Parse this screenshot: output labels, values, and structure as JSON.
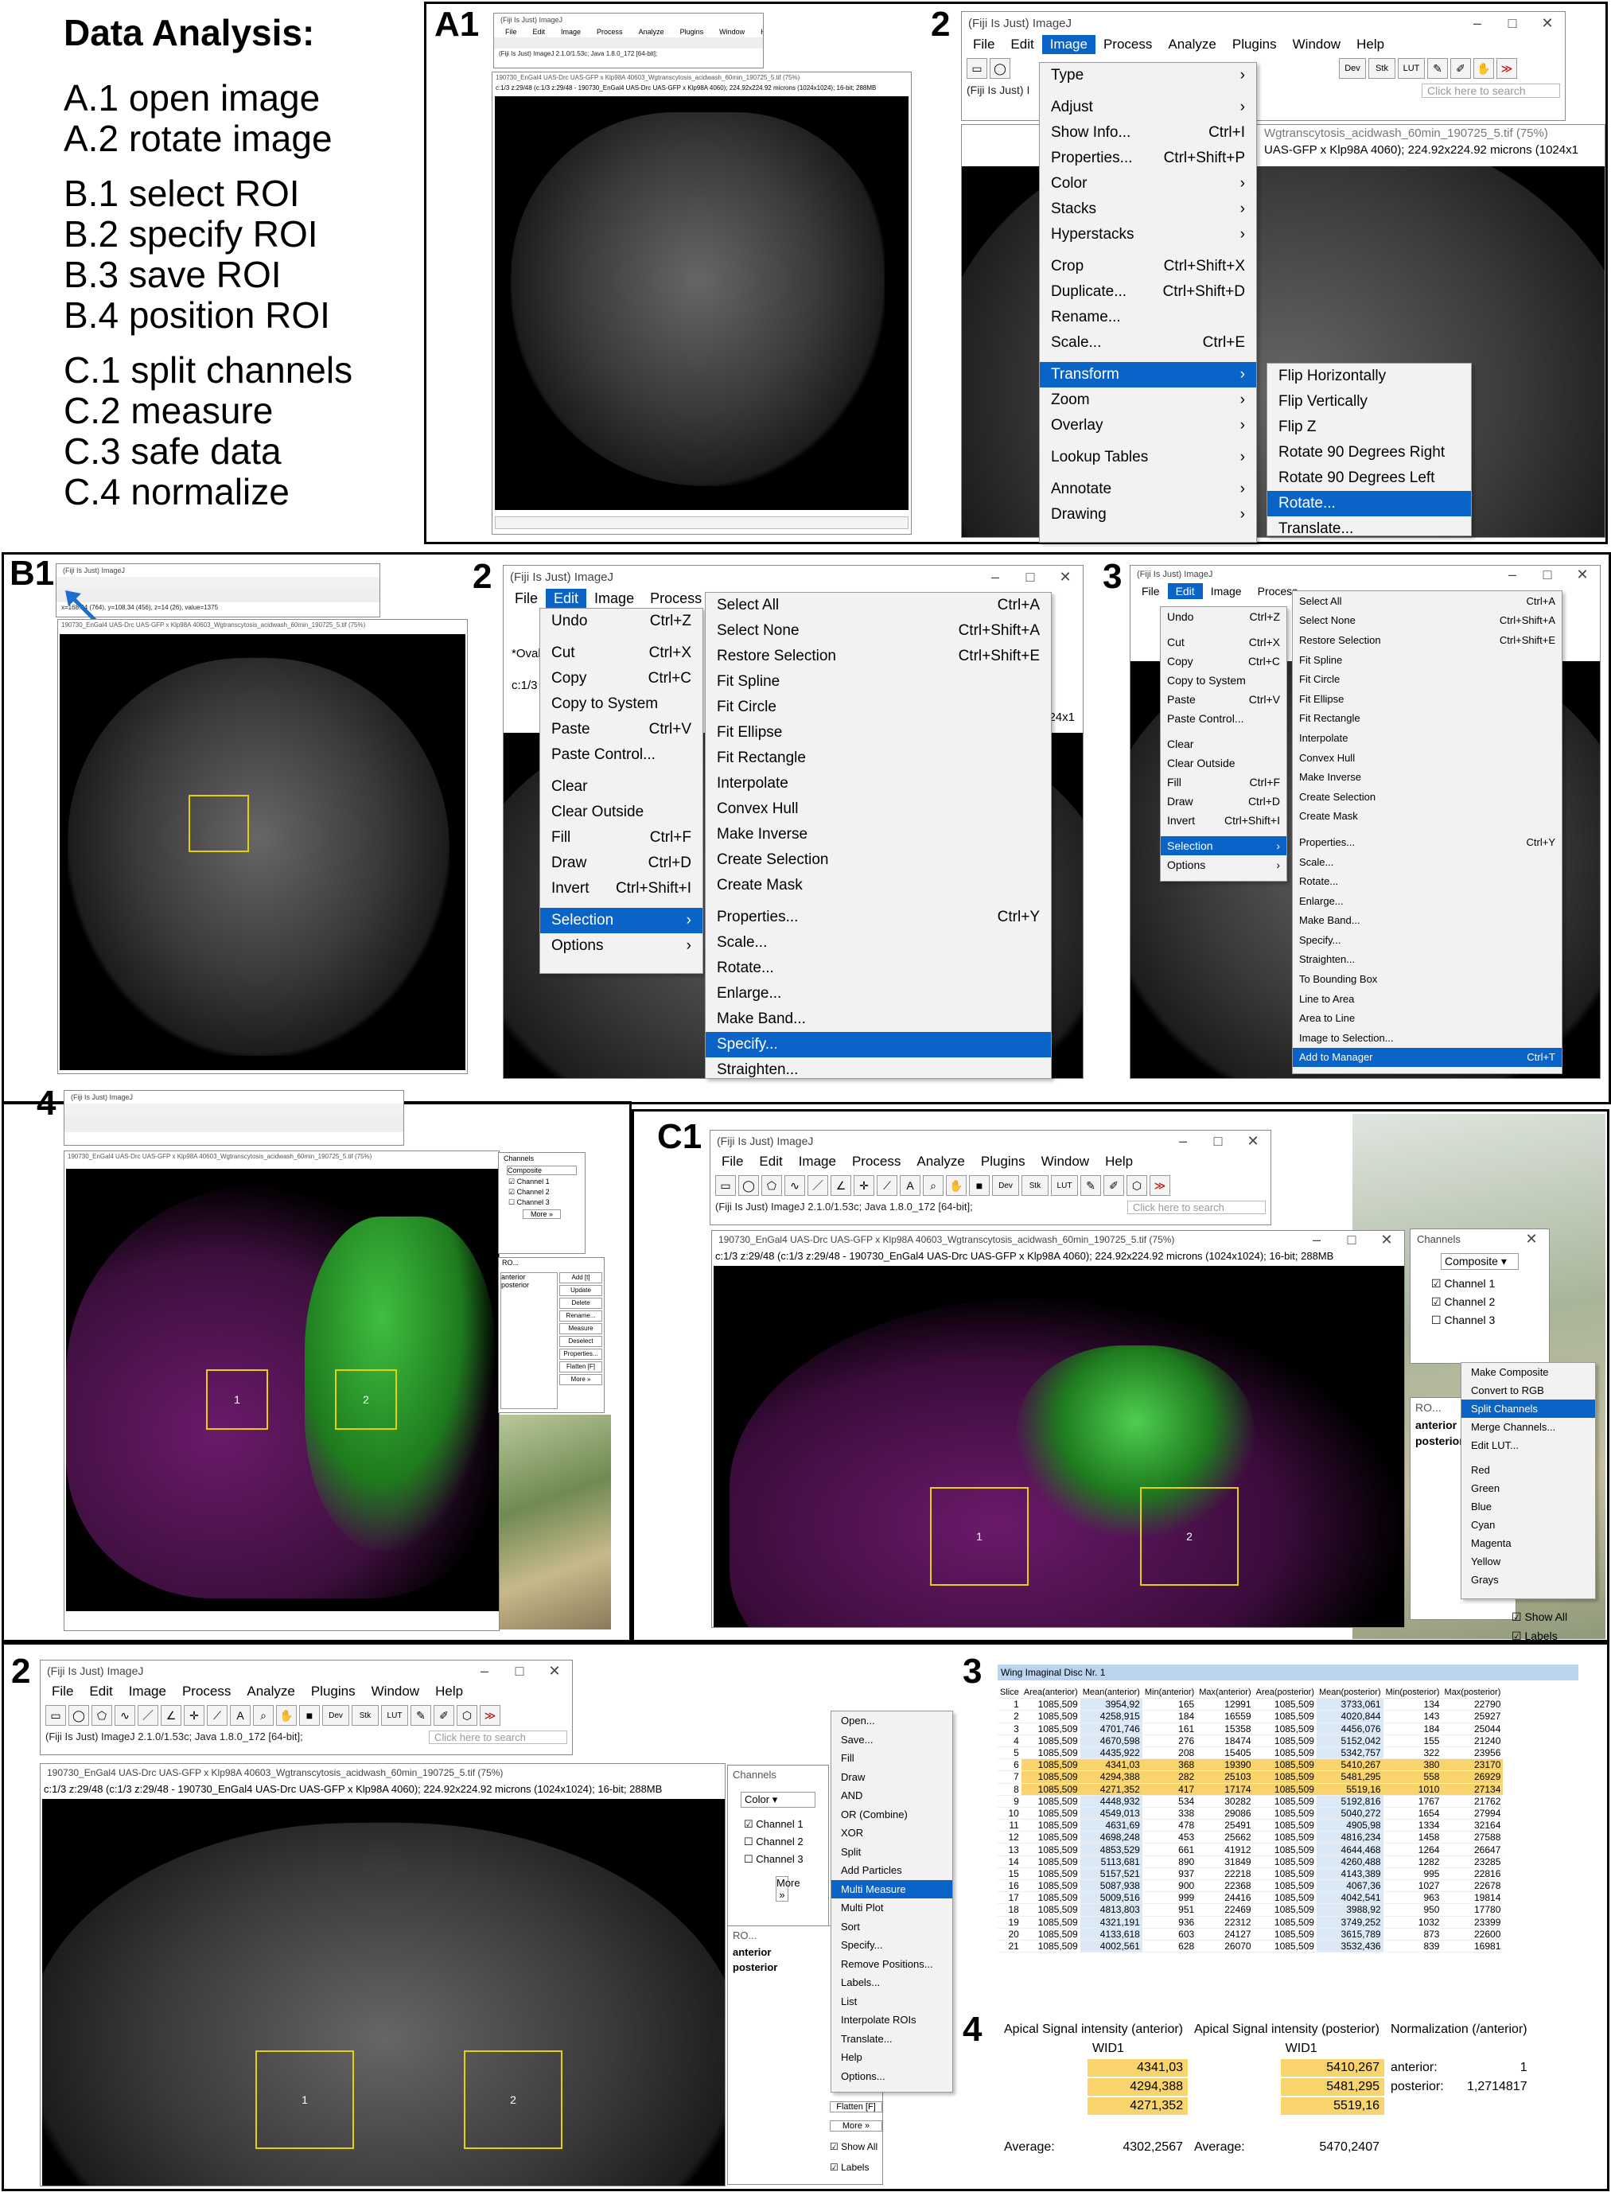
{
  "analysis": {
    "title": "Data Analysis:",
    "steps": [
      "A.1 open image",
      "A.2 rotate image",
      "B.1 select ROI",
      "B.2 specify ROI",
      "B.3 save ROI",
      "B.4 position ROI",
      "C.1 split channels",
      "C.2 measure",
      "C.3 safe data",
      "C.4 normalize"
    ]
  },
  "labels": {
    "a1": "A1",
    "a2": "2",
    "b1": "B1",
    "b2": "2",
    "b3": "3",
    "b4": "4",
    "c1": "C1",
    "c2": "2",
    "c3": "3",
    "c4": "4"
  },
  "imagej": {
    "title": "(Fiji Is Just) ImageJ",
    "menus": [
      "File",
      "Edit",
      "Image",
      "Process",
      "Analyze",
      "Plugins",
      "Window",
      "Help"
    ],
    "status": "(Fiji Is Just) ImageJ 2.1.0/1.53c; Java 1.8.0_172 [64-bit];",
    "status_short": "(Fiji Is Just) I",
    "search_placeholder": "Click here to search",
    "tools": {
      "dev": "Dev",
      "stk": "Stk",
      "lut": "LUT"
    },
    "b1_status": "x=168.34 (764), y=108.34 (456), z=14 (26), value=1375"
  },
  "image_window": {
    "title": "190730_EnGal4 UAS-Drc UAS-GFP  x Klp98A 40603_Wgtranscytosis_acidwash_60min_190725_5.tif (75%)",
    "title_short": "190730_E",
    "title_tail": "Wgtranscytosis_acidwash_60min_190725_5.tif (75%)",
    "info": "c:1/3 z:29/48 (c:1/3 z:29/48 - 190730_EnGal4 UAS-Drc UAS-GFP  x Klp98A 4060); 224.92x224.92 microns (1024x1024); 16-bit; 288MB",
    "info_short": "c:1/3",
    "info_tail": "UAS-GFP  x Klp98A 4060); 224.92x224.92 microns (1024x1",
    "info_b2": "(1024x1",
    "oval_hint": "*Oval*"
  },
  "image_menu": [
    {
      "label": "Type",
      "arrow": "›"
    },
    {
      "label": "Adjust",
      "arrow": "›"
    },
    {
      "label": "Show Info...",
      "sc": "Ctrl+I"
    },
    {
      "label": "Properties...",
      "sc": "Ctrl+Shift+P"
    },
    {
      "label": "Color",
      "arrow": "›"
    },
    {
      "label": "Stacks",
      "arrow": "›"
    },
    {
      "label": "Hyperstacks",
      "arrow": "›"
    },
    {
      "label": "Crop",
      "sc": "Ctrl+Shift+X"
    },
    {
      "label": "Duplicate...",
      "sc": "Ctrl+Shift+D"
    },
    {
      "label": "Rename..."
    },
    {
      "label": "Scale...",
      "sc": "Ctrl+E"
    },
    {
      "label": "Transform",
      "arrow": "›"
    },
    {
      "label": "Zoom",
      "arrow": "›"
    },
    {
      "label": "Overlay",
      "arrow": "›"
    },
    {
      "label": "Lookup Tables",
      "arrow": "›"
    },
    {
      "label": "Annotate",
      "arrow": "›"
    },
    {
      "label": "Drawing",
      "arrow": "›"
    }
  ],
  "transform_menu": [
    "Flip Horizontally",
    "Flip Vertically",
    "Flip Z",
    "Rotate 90 Degrees Right",
    "Rotate 90 Degrees Left",
    "Rotate...",
    "Translate..."
  ],
  "edit_menu": [
    {
      "label": "Undo",
      "sc": "Ctrl+Z"
    },
    {
      "label": "Cut",
      "sc": "Ctrl+X"
    },
    {
      "label": "Copy",
      "sc": "Ctrl+C"
    },
    {
      "label": "Copy to System"
    },
    {
      "label": "Paste",
      "sc": "Ctrl+V"
    },
    {
      "label": "Paste Control..."
    },
    {
      "label": "Clear"
    },
    {
      "label": "Clear Outside"
    },
    {
      "label": "Fill",
      "sc": "Ctrl+F"
    },
    {
      "label": "Draw",
      "sc": "Ctrl+D"
    },
    {
      "label": "Invert",
      "sc": "Ctrl+Shift+I"
    },
    {
      "label": "Selection",
      "arrow": "›"
    },
    {
      "label": "Options",
      "arrow": "›"
    }
  ],
  "selection_menu": [
    {
      "label": "Select All",
      "sc": "Ctrl+A"
    },
    {
      "label": "Select None",
      "sc": "Ctrl+Shift+A"
    },
    {
      "label": "Restore Selection",
      "sc": "Ctrl+Shift+E"
    },
    {
      "label": "Fit Spline"
    },
    {
      "label": "Fit Circle"
    },
    {
      "label": "Fit Ellipse"
    },
    {
      "label": "Fit Rectangle"
    },
    {
      "label": "Interpolate"
    },
    {
      "label": "Convex Hull"
    },
    {
      "label": "Make Inverse"
    },
    {
      "label": "Create Selection"
    },
    {
      "label": "Create Mask"
    },
    {
      "label": "Properties...",
      "sc": "Ctrl+Y"
    },
    {
      "label": "Scale..."
    },
    {
      "label": "Rotate..."
    },
    {
      "label": "Enlarge..."
    },
    {
      "label": "Make Band..."
    },
    {
      "label": "Specify..."
    },
    {
      "label": "Straighten..."
    },
    {
      "label": "To Bounding Box"
    },
    {
      "label": "Line to Area"
    },
    {
      "label": "Area to Line"
    },
    {
      "label": "Image to Selection..."
    },
    {
      "label": "Add to Manager",
      "sc": "Ctrl+T"
    }
  ],
  "channels": {
    "title": "Channels",
    "mode": "Composite",
    "mode_color": "Color",
    "items": [
      "Channel 1",
      "Channel 2",
      "Channel 3"
    ],
    "more": "More »"
  },
  "channels_more_menu": [
    "Make Composite",
    "Convert to RGB",
    "Split Channels",
    "Merge Channels...",
    "Edit LUT...",
    "Red",
    "Green",
    "Blue",
    "Cyan",
    "Magenta",
    "Yellow",
    "Grays"
  ],
  "roi_manager": {
    "title": "RO...",
    "items": [
      "anterior",
      "posterior"
    ],
    "buttons": [
      "Add [t]",
      "Update",
      "Delete",
      "Rename...",
      "Measure",
      "Deselect",
      "Properties...",
      "Flatten [F]",
      "More »"
    ],
    "show_all": "Show All",
    "labels": "Labels"
  },
  "roi_labels": [
    "1",
    "2"
  ],
  "more_menu": [
    "Open...",
    "Save...",
    "Fill",
    "Draw",
    "AND",
    "OR (Combine)",
    "XOR",
    "Split",
    "Add Particles",
    "Multi Measure",
    "Multi Plot",
    "Sort",
    "Specify...",
    "Remove Positions...",
    "Labels...",
    "List",
    "Interpolate ROIs",
    "Translate...",
    "Help",
    "Options..."
  ],
  "sheet": {
    "title": "Wing Imaginal Disc Nr. 1",
    "headers": [
      "Slice",
      "Area(anterior)",
      "Mean(anterior)",
      "Min(anterior)",
      "Max(anterior)",
      "Area(posterior)",
      "Mean(posterior)",
      "Min(posterior)",
      "Max(posterior)"
    ],
    "rows": [
      [
        "1",
        "1085,509",
        "3954,92",
        "165",
        "12991",
        "1085,509",
        "3733,061",
        "134",
        "22790"
      ],
      [
        "2",
        "1085,509",
        "4258,915",
        "184",
        "16559",
        "1085,509",
        "4020,844",
        "143",
        "25927"
      ],
      [
        "3",
        "1085,509",
        "4701,746",
        "161",
        "15358",
        "1085,509",
        "4456,076",
        "184",
        "25044"
      ],
      [
        "4",
        "1085,509",
        "4670,598",
        "276",
        "18474",
        "1085,509",
        "5152,042",
        "155",
        "21240"
      ],
      [
        "5",
        "1085,509",
        "4435,922",
        "208",
        "15405",
        "1085,509",
        "5342,757",
        "322",
        "23956"
      ],
      [
        "6",
        "1085,509",
        "4341,03",
        "368",
        "19390",
        "1085,509",
        "5410,267",
        "380",
        "23170"
      ],
      [
        "7",
        "1085,509",
        "4294,388",
        "282",
        "25103",
        "1085,509",
        "5481,295",
        "558",
        "26929"
      ],
      [
        "8",
        "1085,509",
        "4271,352",
        "417",
        "17174",
        "1085,509",
        "5519,16",
        "1010",
        "27134"
      ],
      [
        "9",
        "1085,509",
        "4448,932",
        "534",
        "30282",
        "1085,509",
        "5192,816",
        "1767",
        "21762"
      ],
      [
        "10",
        "1085,509",
        "4549,013",
        "338",
        "29086",
        "1085,509",
        "5040,272",
        "1654",
        "27994"
      ],
      [
        "11",
        "1085,509",
        "4631,69",
        "478",
        "25491",
        "1085,509",
        "4905,98",
        "1334",
        "32164"
      ],
      [
        "12",
        "1085,509",
        "4698,248",
        "453",
        "25662",
        "1085,509",
        "4816,234",
        "1458",
        "27588"
      ],
      [
        "13",
        "1085,509",
        "4853,529",
        "661",
        "41912",
        "1085,509",
        "4644,468",
        "1264",
        "26647"
      ],
      [
        "14",
        "1085,509",
        "5113,681",
        "890",
        "31849",
        "1085,509",
        "4260,488",
        "1282",
        "23285"
      ],
      [
        "15",
        "1085,509",
        "5157,521",
        "937",
        "22218",
        "1085,509",
        "4143,389",
        "995",
        "22816"
      ],
      [
        "16",
        "1085,509",
        "5087,938",
        "900",
        "22368",
        "1085,509",
        "4067,36",
        "1027",
        "22678"
      ],
      [
        "17",
        "1085,509",
        "5009,516",
        "999",
        "24416",
        "1085,509",
        "4042,541",
        "963",
        "19814"
      ],
      [
        "18",
        "1085,509",
        "4813,803",
        "951",
        "22469",
        "1085,509",
        "3988,92",
        "950",
        "17780"
      ],
      [
        "19",
        "1085,509",
        "4321,191",
        "936",
        "22312",
        "1085,509",
        "3749,252",
        "1032",
        "23399"
      ],
      [
        "20",
        "1085,509",
        "4133,618",
        "603",
        "24127",
        "1085,509",
        "3615,789",
        "873",
        "22600"
      ],
      [
        "21",
        "1085,509",
        "4002,561",
        "628",
        "26070",
        "1085,509",
        "3532,436",
        "839",
        "16981"
      ]
    ],
    "highlight_rows": [
      5,
      6,
      7
    ]
  },
  "signal": {
    "anterior_header": "Apical Signal intensity (anterior)",
    "posterior_header": "Apical Signal intensity (posterior)",
    "norm_header": "Normalization (/anterior)",
    "wid": "WID1",
    "anterior_values": [
      "4341,03",
      "4294,388",
      "4271,352"
    ],
    "posterior_values": [
      "5410,267",
      "5481,295",
      "5519,16"
    ],
    "average_label": "Average:",
    "anterior_avg": "4302,2567",
    "posterior_avg": "5470,2407",
    "norm_anterior_label": "anterior:",
    "norm_anterior_value": "1",
    "norm_posterior_label": "posterior:",
    "norm_posterior_value": "1,2714817"
  }
}
